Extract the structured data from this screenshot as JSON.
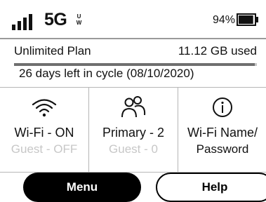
{
  "status": {
    "network": "5G",
    "network_suffix": "UW",
    "battery_text": "94%",
    "battery_level": 0.94
  },
  "plan": {
    "name": "Unlimited Plan",
    "used": "11.12 GB used",
    "cycle": "26 days left in cycle (08/10/2020)",
    "usage_fraction": 0.99
  },
  "tiles": [
    {
      "icon": "wifi-icon",
      "line1": "Wi-Fi - ON",
      "line2": "Guest - OFF"
    },
    {
      "icon": "users-icon",
      "line1": "Primary - 2",
      "line2": "Guest - 0"
    },
    {
      "icon": "info-icon",
      "line1": "Wi-Fi Name/",
      "line2": "Password"
    }
  ],
  "buttons": {
    "menu": "Menu",
    "help": "Help"
  },
  "colors": {
    "accent": "#000000",
    "muted_text": "#c7c7c7",
    "divider": "#b6b6b6"
  }
}
